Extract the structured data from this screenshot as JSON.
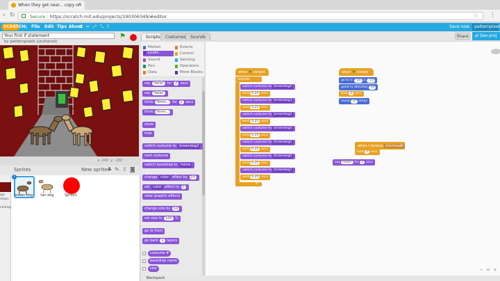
{
  "browser": {
    "tab_title": "When they get near... copy on",
    "secure_label": "Secure",
    "url": "https://scratch.mit.edu/projects/190306349/#editor"
  },
  "scratch_menu": {
    "logo": "SCRATCH",
    "items": [
      "File",
      "Edit",
      "Tips",
      "About"
    ],
    "save_status": "Save now",
    "user": "patternpixels"
  },
  "stage": {
    "project_title": "Your first if statement",
    "byline": "by patternpixels (unshared)",
    "coords_x": "x: 240",
    "coords_y": "y: -180"
  },
  "sprites": {
    "header": "Sprites",
    "new_sprite_label": "New sprite:",
    "items": [
      {
        "name": "brown dog",
        "selected": true
      },
      {
        "name": "tan dog",
        "selected": false
      },
      {
        "name": "Sprite1",
        "selected": false
      }
    ],
    "stage_labels": [
      "ige",
      "drops",
      "ckdrop:"
    ],
    "info_badge": "i"
  },
  "editor_tabs": [
    "Scripts",
    "Costumes",
    "Sounds"
  ],
  "share_label": "Share",
  "see_project_label": "See proj",
  "categories": [
    {
      "label": "Motion",
      "color": "#4a6cd4"
    },
    {
      "label": "Looks",
      "color": "#8a55d7",
      "active": true
    },
    {
      "label": "Sound",
      "color": "#bb42c3"
    },
    {
      "label": "Pen",
      "color": "#0e9a6c"
    },
    {
      "label": "Data",
      "color": "#ee7d16"
    },
    {
      "label": "Events",
      "color": "#c88330"
    },
    {
      "label": "Control",
      "color": "#e1a91a"
    },
    {
      "label": "Sensing",
      "color": "#2ca5e2"
    },
    {
      "label": "Operators",
      "color": "#5cb712"
    },
    {
      "label": "More Blocks",
      "color": "#632d99"
    }
  ],
  "palette": {
    "say_for": [
      "say",
      "Hello!",
      "for",
      "2",
      "secs"
    ],
    "say": [
      "say",
      "Hello!"
    ],
    "think_for": [
      "think",
      "Hmm...",
      "for",
      "2",
      "secs"
    ],
    "think": [
      "think",
      "Hmm..."
    ],
    "show": "show",
    "hide": "hide",
    "switch_costume": [
      "switch costume to",
      "browndog2"
    ],
    "next_costume": "next costume",
    "switch_backdrop": [
      "switch backdrop to",
      "home"
    ],
    "change_effect": [
      "change",
      "color",
      "effect by",
      "25"
    ],
    "set_effect": [
      "set",
      "color",
      "effect to",
      "0"
    ],
    "clear_effects": "clear graphic effects",
    "change_size": [
      "change size by",
      "10"
    ],
    "set_size": [
      "set size to",
      "100",
      "%"
    ],
    "go_front": "go to front",
    "go_back": [
      "go back",
      "1",
      "layers"
    ],
    "costume_num": "costume #",
    "backdrop_name": "backdrop name",
    "size": "size"
  },
  "script1": {
    "hat": [
      "when",
      "clicked"
    ],
    "forever": "forever",
    "steps": [
      {
        "op": "switch costume to",
        "arg": "browndog2"
      },
      {
        "op": "wait",
        "arg": "0.25",
        "unit": "secs"
      },
      {
        "op": "switch costume to",
        "arg": "browndog3"
      },
      {
        "op": "wait",
        "arg": "0.25",
        "unit": "secs"
      },
      {
        "op": "switch costume to",
        "arg": "browndog2"
      },
      {
        "op": "wait",
        "arg": "0.25",
        "unit": "secs"
      },
      {
        "op": "switch costume to",
        "arg": "browndog4"
      },
      {
        "op": "wait",
        "arg": "0.25",
        "unit": "secs"
      },
      {
        "op": "switch costume to",
        "arg": "browndog5"
      },
      {
        "op": "wait",
        "arg": "0.25",
        "unit": "secs"
      },
      {
        "op": "switch costume to",
        "arg": "browndog6"
      },
      {
        "op": "wait",
        "arg": "0.25",
        "unit": "secs"
      },
      {
        "op": "switch costume to",
        "arg": "browndog7"
      },
      {
        "op": "wait",
        "arg": "0.25",
        "unit": "secs"
      }
    ]
  },
  "script2": {
    "hat": [
      "when",
      "clicked"
    ],
    "goto": [
      "go to x:",
      "-50",
      "y:",
      "-70"
    ],
    "point": [
      "point in direction",
      "90"
    ],
    "wait": [
      "wait",
      "2",
      "secs"
    ],
    "move": [
      "move",
      "10",
      "steps"
    ]
  },
  "script3": {
    "hat": [
      "when I receive",
      "startowalk"
    ],
    "wait": [
      "wait",
      "2",
      "secs"
    ]
  },
  "script4": {
    "say": [
      "say",
      "Hello!",
      "for",
      "2",
      "secs"
    ]
  },
  "backpack_label": "Backpack"
}
